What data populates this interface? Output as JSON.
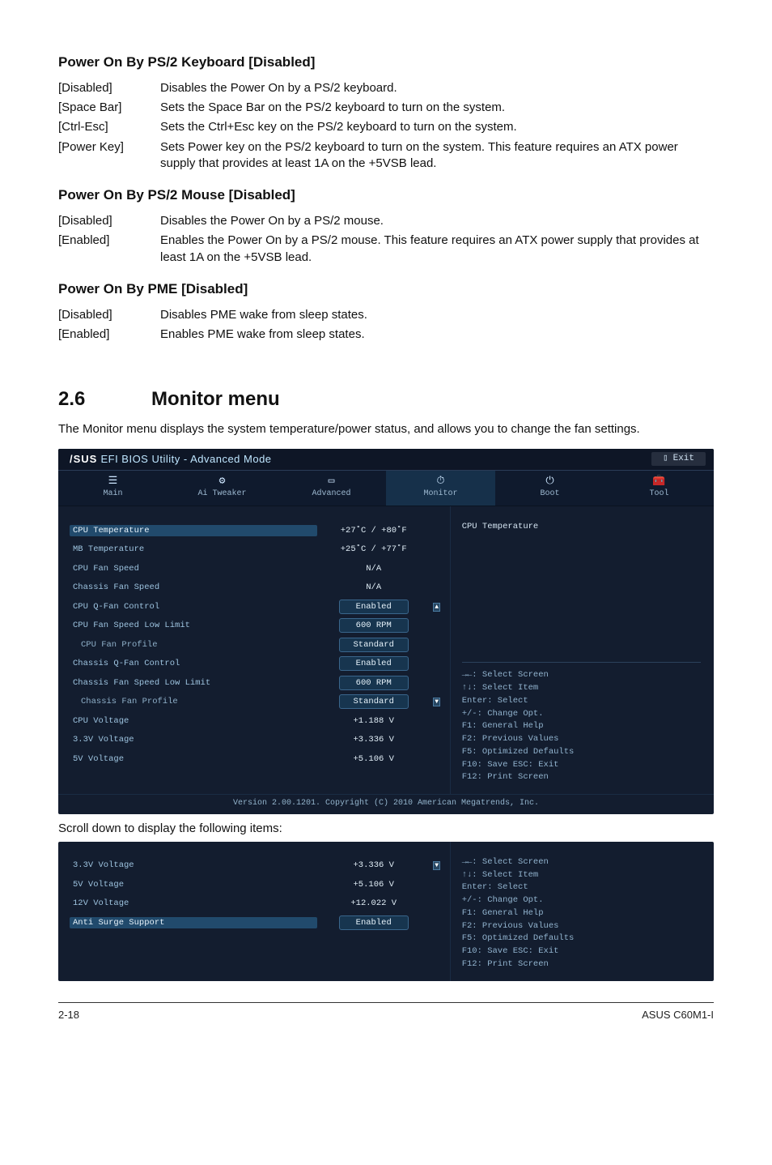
{
  "sections": {
    "kbd": {
      "title": "Power On By PS/2 Keyboard [Disabled]",
      "rows": [
        {
          "k": "[Disabled]",
          "d": "Disables the Power On by a PS/2 keyboard."
        },
        {
          "k": "[Space Bar]",
          "d": "Sets the Space Bar on the PS/2 keyboard to turn on the system."
        },
        {
          "k": "[Ctrl-Esc]",
          "d": "Sets the Ctrl+Esc key on the PS/2 keyboard to turn on the system."
        },
        {
          "k": "[Power Key]",
          "d": "Sets Power key on the PS/2 keyboard to turn on the system. This feature requires an ATX power supply that provides at least 1A on the +5VSB lead."
        }
      ]
    },
    "mouse": {
      "title": "Power On By PS/2 Mouse [Disabled]",
      "rows": [
        {
          "k": "[Disabled]",
          "d": "Disables the Power On by a PS/2 mouse."
        },
        {
          "k": "[Enabled]",
          "d": "Enables the Power On by a PS/2 mouse. This feature requires an ATX power supply that provides at least 1A on the +5VSB lead."
        }
      ]
    },
    "pme": {
      "title": "Power On By PME [Disabled]",
      "rows": [
        {
          "k": "[Disabled]",
          "d": "Disables PME wake from sleep states."
        },
        {
          "k": "[Enabled]",
          "d": "Enables PME wake from sleep states."
        }
      ]
    }
  },
  "monitor_menu": {
    "num": "2.6",
    "title": "Monitor menu",
    "intro": "The Monitor menu displays the system temperature/power status, and allows you to change the fan settings."
  },
  "bios": {
    "brand_prefix": "/SUS",
    "brand_rest": " EFI BIOS Utility - Advanced Mode",
    "exit": "Exit",
    "tabs": {
      "main": "Main",
      "ai": "Ai Tweaker",
      "adv": "Advanced",
      "monitor": "Monitor",
      "boot": "Boot",
      "tool": "Tool"
    },
    "help_title": "CPU Temperature",
    "hints": "→←: Select Screen\n↑↓: Select Item\nEnter: Select\n+/-: Change Opt.\nF1: General Help\nF2: Previous Values\nF5: Optimized Defaults\nF10: Save  ESC: Exit\nF12: Print Screen",
    "items": [
      {
        "label": "CPU Temperature",
        "value": "+27˚C / +80˚F",
        "box": false,
        "hl": true
      },
      {
        "label": "MB Temperature",
        "value": "+25˚C / +77˚F",
        "box": false
      },
      {
        "label": "CPU Fan Speed",
        "value": "N/A",
        "box": false
      },
      {
        "label": "Chassis Fan Speed",
        "value": "N/A",
        "box": false
      },
      {
        "label": "CPU Q-Fan Control",
        "value": "Enabled",
        "box": true,
        "up": true
      },
      {
        "label": "CPU Fan Speed Low Limit",
        "value": "600 RPM",
        "box": true
      },
      {
        "label": "CPU Fan Profile",
        "value": "Standard",
        "box": true,
        "sub": true
      },
      {
        "label": "Chassis Q-Fan Control",
        "value": "Enabled",
        "box": true
      },
      {
        "label": "Chassis Fan Speed Low Limit",
        "value": "600 RPM",
        "box": true
      },
      {
        "label": "Chassis Fan Profile",
        "value": "Standard",
        "box": true,
        "sub": true,
        "down": true
      },
      {
        "label": "CPU Voltage",
        "value": "+1.188 V",
        "box": false
      },
      {
        "label": "3.3V Voltage",
        "value": "+3.336 V",
        "box": false
      },
      {
        "label": "5V Voltage",
        "value": "+5.106 V",
        "box": false
      }
    ],
    "footer": "Version 2.00.1201. Copyright (C) 2010 American Megatrends, Inc."
  },
  "scroll_note": "Scroll down to display the following items:",
  "bios2": {
    "hints": "→←: Select Screen\n↑↓: Select Item\nEnter: Select\n+/-: Change Opt.\nF1: General Help\nF2: Previous Values\nF5: Optimized Defaults\nF10: Save  ESC: Exit\nF12: Print Screen",
    "items": [
      {
        "label": "3.3V Voltage",
        "value": "+3.336 V",
        "box": false,
        "down": true
      },
      {
        "label": "5V Voltage",
        "value": "+5.106 V",
        "box": false
      },
      {
        "label": "12V Voltage",
        "value": "+12.022 V",
        "box": false
      },
      {
        "label": "Anti Surge Support",
        "value": "Enabled",
        "box": true,
        "hl": true
      }
    ]
  },
  "footer": {
    "left": "2-18",
    "right": "ASUS C60M1-I"
  }
}
